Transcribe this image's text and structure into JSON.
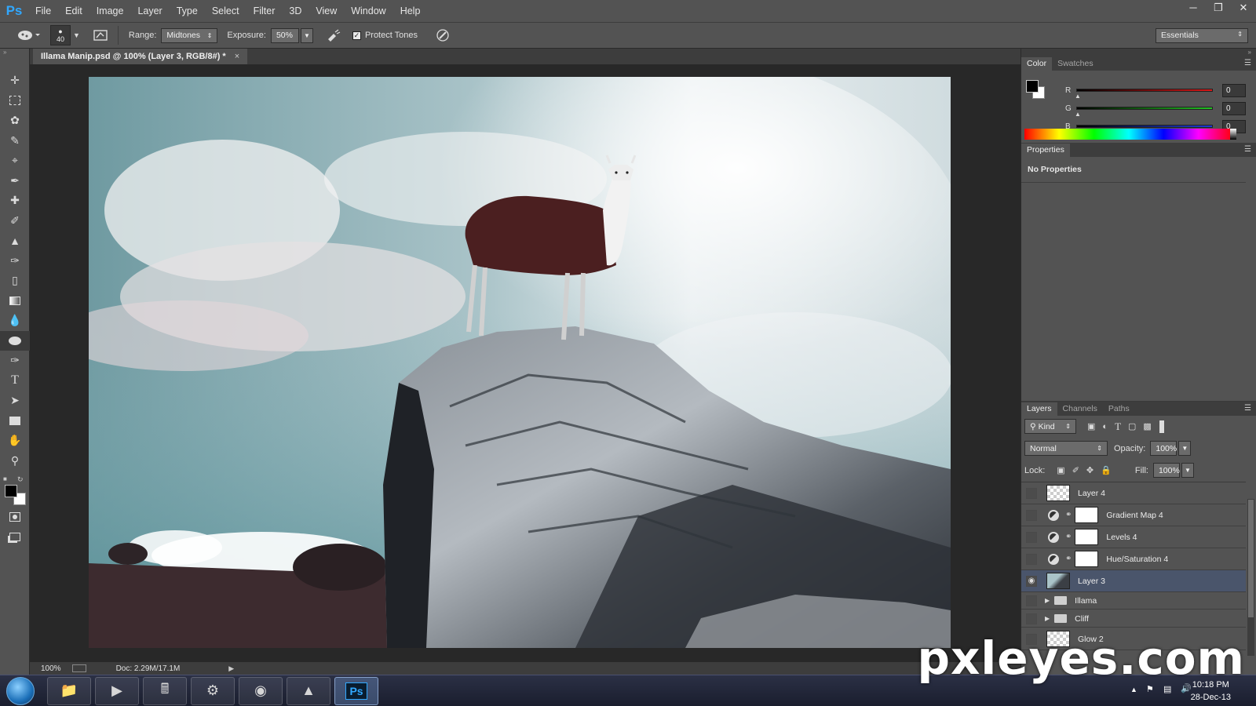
{
  "menu": {
    "logo": "Ps",
    "items": [
      "File",
      "Edit",
      "Image",
      "Layer",
      "Type",
      "Select",
      "Filter",
      "3D",
      "View",
      "Window",
      "Help"
    ]
  },
  "options": {
    "brush_size": "40",
    "range_label": "Range:",
    "range_value": "Midtones",
    "exposure_label": "Exposure:",
    "exposure_value": "50%",
    "protect_tones_label": "Protect Tones",
    "workspace": "Essentials"
  },
  "document": {
    "tab_title": "Illama Manip.psd @ 100% (Layer 3, RGB/8#) *",
    "zoom": "100%",
    "doc_info": "Doc: 2.29M/17.1M"
  },
  "color_panel": {
    "tabs": [
      "Color",
      "Swatches"
    ],
    "channels": [
      {
        "label": "R",
        "value": "0",
        "color": "#d81818"
      },
      {
        "label": "G",
        "value": "0",
        "color": "#22c022"
      },
      {
        "label": "B",
        "value": "0",
        "color": "#1c3ad8"
      }
    ]
  },
  "properties_panel": {
    "tab": "Properties",
    "message": "No Properties"
  },
  "layers_panel": {
    "tabs": [
      "Layers",
      "Channels",
      "Paths"
    ],
    "filter_kind": "Kind",
    "blend_mode": "Normal",
    "opacity_label": "Opacity:",
    "opacity_value": "100%",
    "lock_label": "Lock:",
    "fill_label": "Fill:",
    "fill_value": "100%",
    "layers": [
      {
        "name": "Layer 4",
        "type": "pixel",
        "visible": false,
        "selected": false
      },
      {
        "name": "Gradient Map 4",
        "type": "adjustment",
        "visible": false,
        "selected": false
      },
      {
        "name": "Levels 4",
        "type": "adjustment",
        "visible": false,
        "selected": false
      },
      {
        "name": "Hue/Saturation 4",
        "type": "adjustment",
        "visible": false,
        "selected": false
      },
      {
        "name": "Layer 3",
        "type": "image",
        "visible": true,
        "selected": true
      },
      {
        "name": "Illama",
        "type": "group",
        "visible": false,
        "selected": false
      },
      {
        "name": "Cliff",
        "type": "group",
        "visible": false,
        "selected": false
      },
      {
        "name": "Glow 2",
        "type": "pixel",
        "visible": false,
        "selected": false
      }
    ]
  },
  "taskbar": {
    "time": "10:18 PM",
    "date": "28-Dec-13"
  },
  "watermark": "pxleyes.com"
}
